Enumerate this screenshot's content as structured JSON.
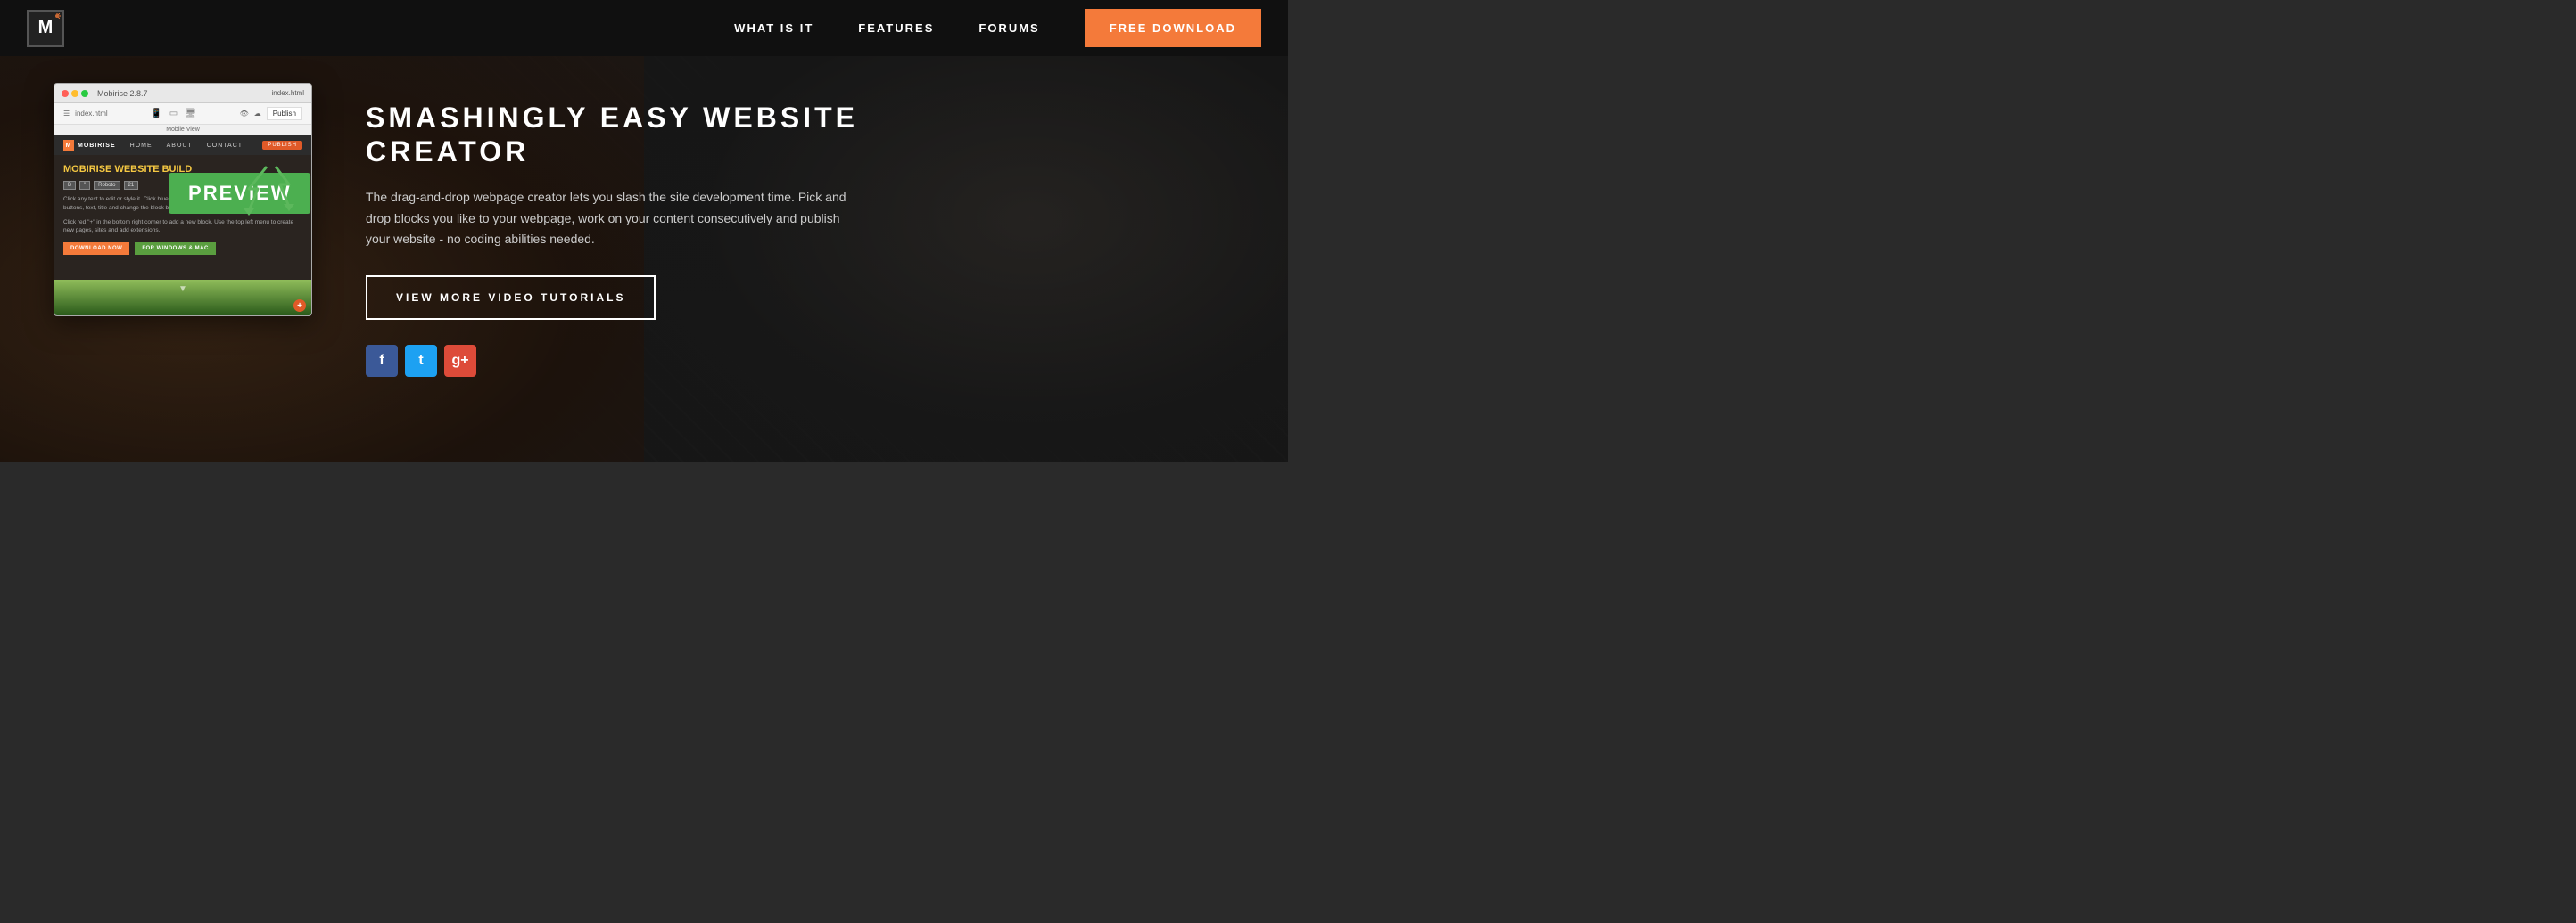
{
  "navbar": {
    "logo_letter": "M",
    "links": [
      {
        "id": "what-is-it",
        "label": "WHAT IS IT"
      },
      {
        "id": "features",
        "label": "FEATURES"
      },
      {
        "id": "forums",
        "label": "FORUMS"
      }
    ],
    "download_btn": "FREE DOWNLOAD"
  },
  "app_window": {
    "title": "Mobirise 2.8.7",
    "filename": "index.html",
    "publish_label": "Publish",
    "view_label": "Mobile View",
    "inner_nav": [
      "HOME",
      "ABOUT",
      "CONTACT"
    ],
    "inner_brand": "MOBIRISE",
    "body_title": "MOBIRISE WEBSITE BUILD",
    "body_text_1": "Click any text to edit or style it. Click blue \"Gear\" icon in the top right corner to hide/show buttons, text, title and change the block background.",
    "body_text_2": "Click red \"+\" in the bottom right corner to add a new block. Use the top left menu to create new pages, sites and add extensions.",
    "btn_download": "DOWNLOAD NOW",
    "btn_windows": "FOR WINDOWS & MAC"
  },
  "preview_label": "PREVIEW",
  "hero": {
    "title_line1": "SMASHINGLY EASY WEBSITE",
    "title_line2": "CREATOR",
    "description": "The drag-and-drop webpage creator lets you slash the site development time. Pick and drop blocks you like to your webpage, work on your content consecutively and publish your website - no coding abilities needed.",
    "tutorials_btn": "VIEW MORE VIDEO TUTORIALS"
  },
  "social": {
    "items": [
      {
        "id": "facebook",
        "icon": "f",
        "class": "social-fb"
      },
      {
        "id": "twitter",
        "icon": "t",
        "class": "social-tw"
      },
      {
        "id": "googleplus",
        "icon": "g+",
        "class": "social-gp"
      }
    ]
  },
  "platform_text": "For Windows Mac"
}
